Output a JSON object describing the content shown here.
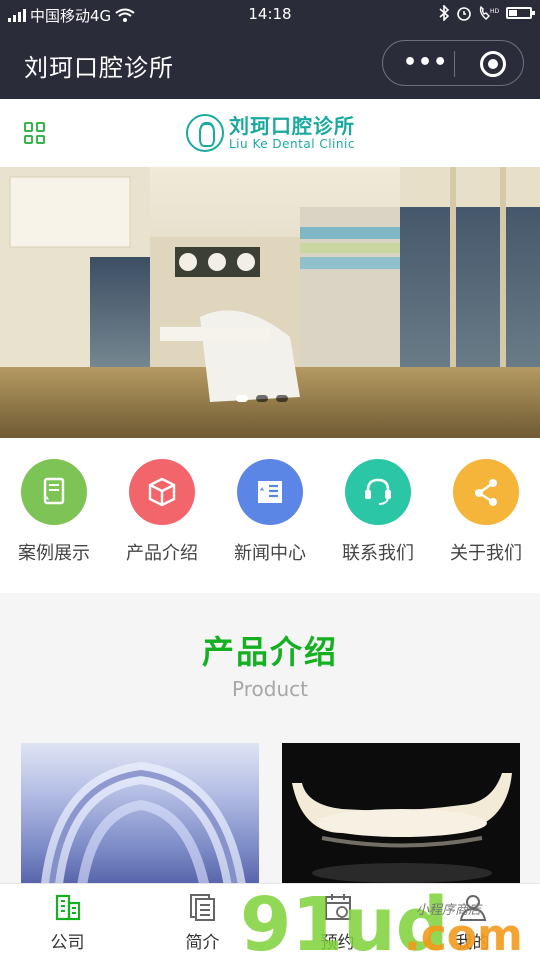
{
  "status_bar": {
    "carrier": "中国移动4G",
    "time": "14:18"
  },
  "nav": {
    "title": "刘珂口腔诊所",
    "more_label": "•••"
  },
  "header": {
    "logo_cn": "刘珂口腔诊所",
    "logo_en": "Liu Ke Dental Clinic"
  },
  "banner": {
    "slides": 3,
    "active_slide": 1
  },
  "quick_links": [
    {
      "label": "案例展示",
      "icon": "cases-icon",
      "color": "#7dc356"
    },
    {
      "label": "产品介绍",
      "icon": "box-icon",
      "color": "#f2666b"
    },
    {
      "label": "新闻中心",
      "icon": "news-icon",
      "color": "#5c86e6"
    },
    {
      "label": "联系我们",
      "icon": "headset-icon",
      "color": "#2bc6a6"
    },
    {
      "label": "关于我们",
      "icon": "share-icon",
      "color": "#f5b53a"
    }
  ],
  "products_section": {
    "title": "产品介绍",
    "subtitle": "Product",
    "items": [
      {
        "image": "clear-aligner-photo"
      },
      {
        "image": "dental-bridge-photo"
      }
    ]
  },
  "tabbar": [
    {
      "label": "公司",
      "icon": "building-icon",
      "active": true
    },
    {
      "label": "简介",
      "icon": "document-icon",
      "active": false
    },
    {
      "label": "预约",
      "icon": "calendar-icon",
      "active": false
    },
    {
      "label": "我的",
      "icon": "user-icon",
      "active": false
    }
  ],
  "watermark": {
    "text": "91ud.com",
    "tag": "小程序商店"
  },
  "colors": {
    "accent": "#14b021",
    "nav_bg": "#2b2c3a",
    "logo": "#1aa9a0"
  }
}
